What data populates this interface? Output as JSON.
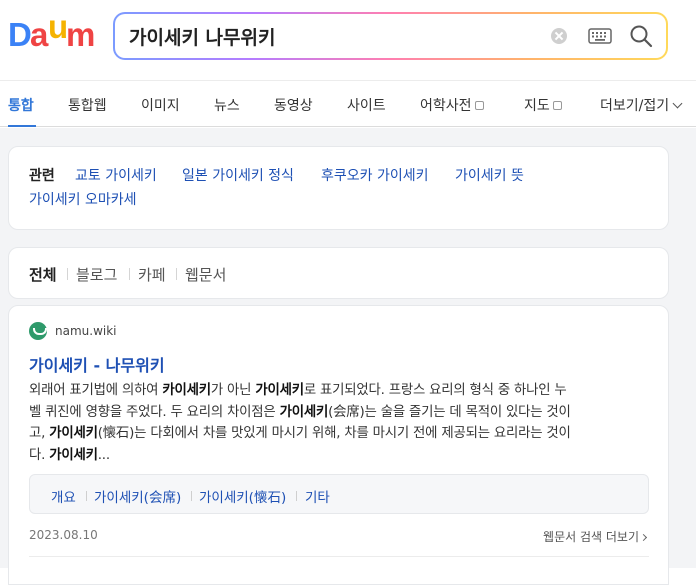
{
  "logo": {
    "text": "Daum",
    "letters": [
      {
        "ch": "D",
        "color": "#3b82f6"
      },
      {
        "ch": "a",
        "color": "#ef4444"
      },
      {
        "ch": "u",
        "color": "#f5b301"
      },
      {
        "ch": "m",
        "color": "#ef4444"
      }
    ]
  },
  "search": {
    "query": "가이세키 나무위키",
    "clear_icon": "clear-circle-icon",
    "keyboard_icon": "keyboard-icon",
    "search_icon": "magnifier-icon"
  },
  "tabs": [
    {
      "label": "통합",
      "active": true
    },
    {
      "label": "통합웹"
    },
    {
      "label": "이미지"
    },
    {
      "label": "뉴스"
    },
    {
      "label": "동영상"
    },
    {
      "label": "사이트"
    },
    {
      "label": "어학사전",
      "external": true
    },
    {
      "label": "지도",
      "external": true
    },
    {
      "label": "더보기/접기",
      "dropdown": true
    }
  ],
  "related": {
    "title": "관련",
    "links": [
      "교토 가이세키",
      "일본 가이세키 정식",
      "후쿠오카 가이세키",
      "가이세키 뜻",
      "가이세키 오마카세"
    ]
  },
  "filters": [
    {
      "label": "전체",
      "active": true
    },
    {
      "label": "블로그"
    },
    {
      "label": "카페"
    },
    {
      "label": "웹문서"
    }
  ],
  "result": {
    "site": "namu.wiki",
    "title": "가이세키 - 나무위키",
    "snippet_lines": [
      "외래어 표기법에 의하여 <b>카이세키</b>가 아닌 <b>가이세키</b>로 표기되었다. 프랑스 요리의 형식 중 하나인 누",
      "벨 퀴진에 영향을 주었다. 두 요리의 차이점은 <b>가이세키</b>(会席)는 술을 즐기는 데 목적이 있다는 것이",
      "고, <b>가이세키</b>(懐石)는 다회에서 차를 맛있게 마시기 위해, 차를 마시기 전에 제공되는 요리라는 것이",
      "다. <b>가이세키</b>..."
    ],
    "sitelinks": [
      "개요",
      "가이세키(会席)",
      "가이세키(懐石)",
      "기타"
    ],
    "date": "2023.08.10",
    "more": "웹문서 검색 더보기"
  },
  "colors": {
    "accent": "#3277d8",
    "link": "#1e50b4",
    "background": "#f3f4f6"
  }
}
